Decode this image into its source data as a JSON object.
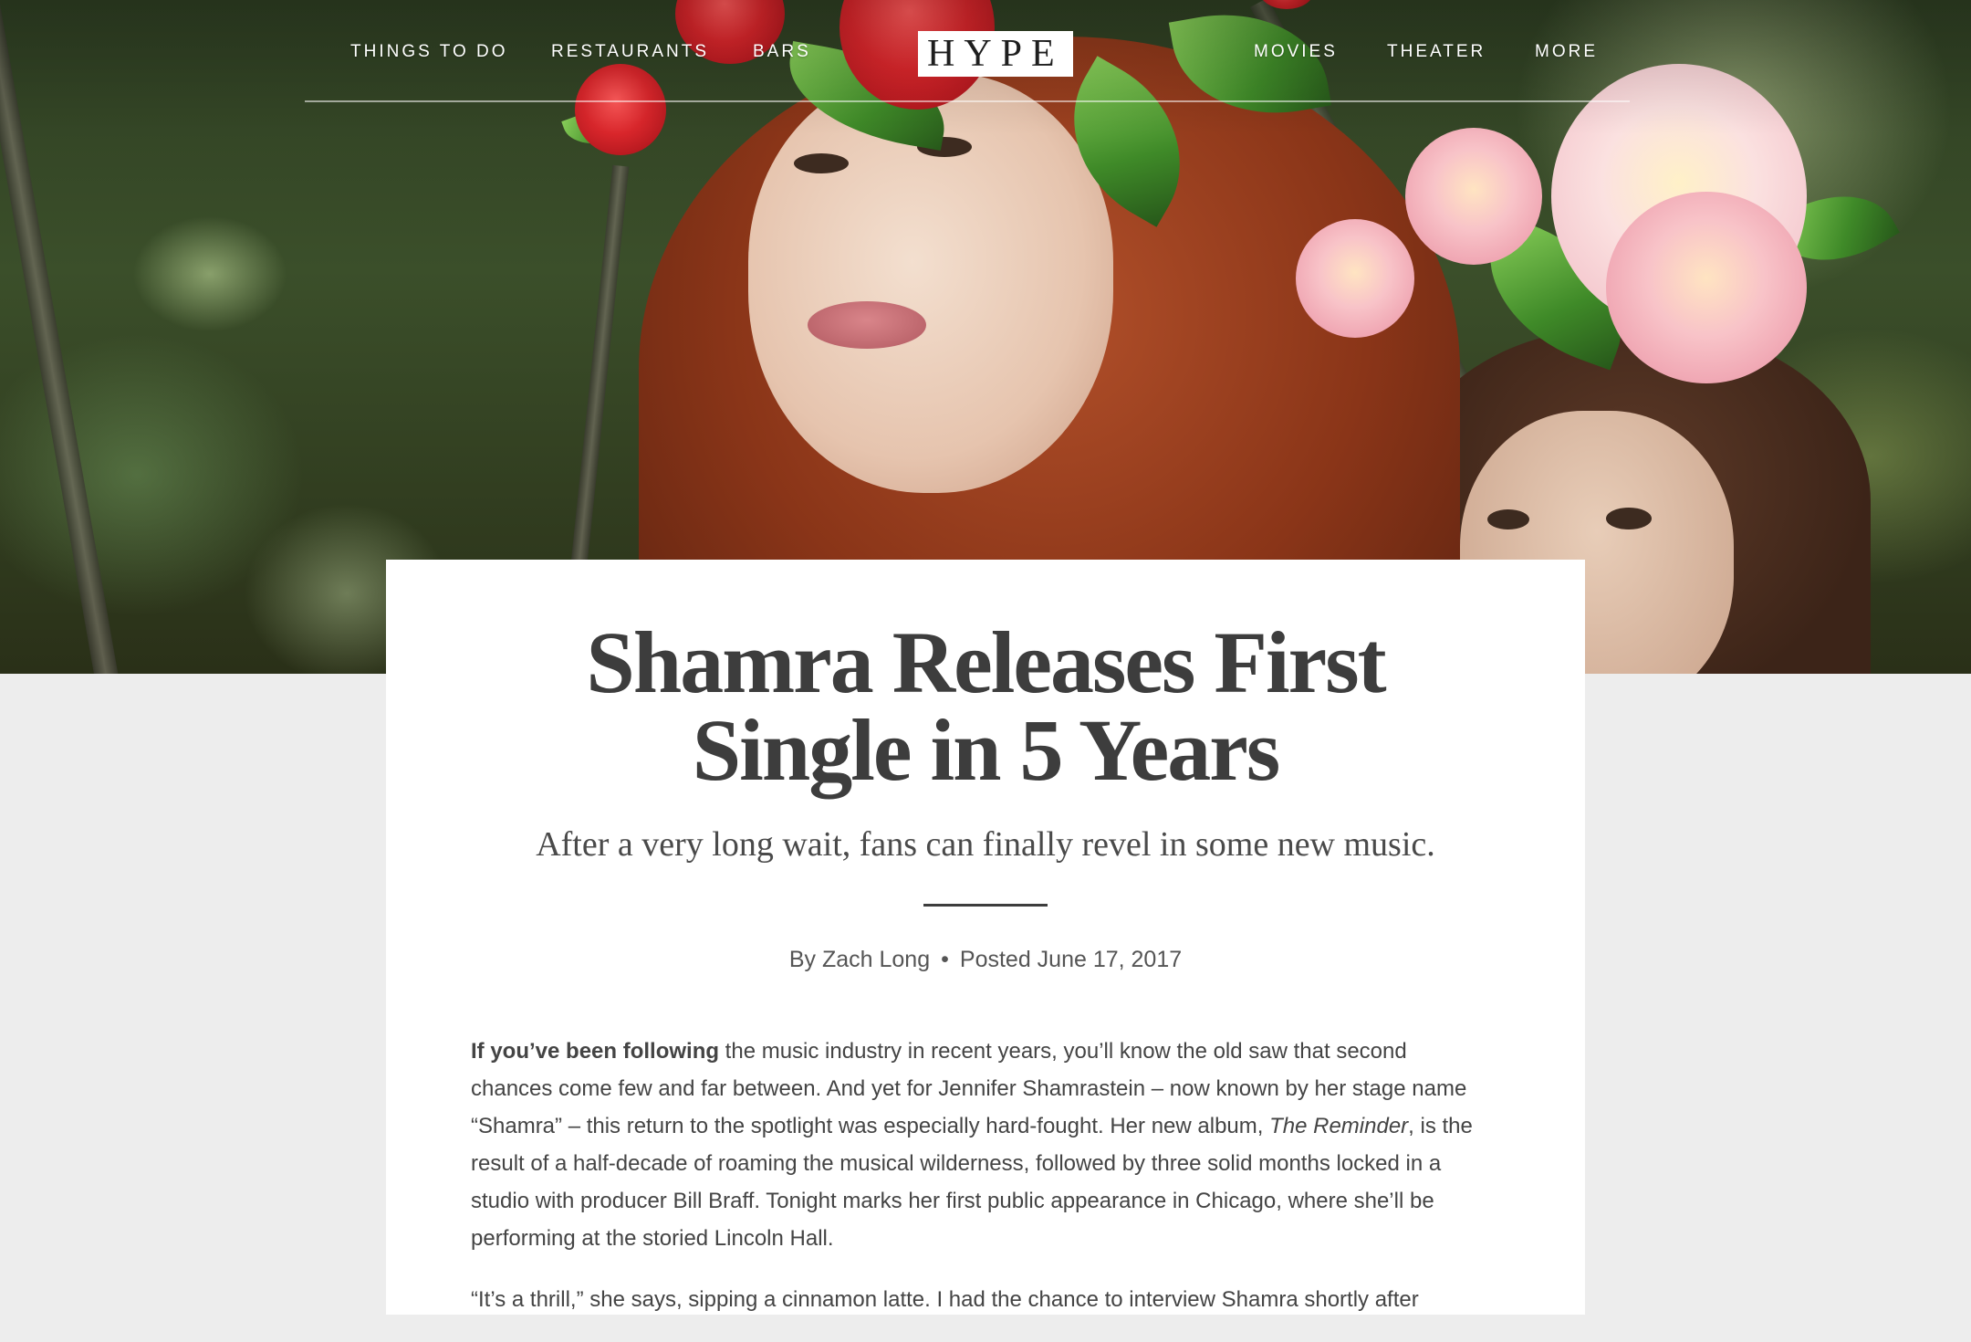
{
  "nav": {
    "left": [
      "THINGS TO DO",
      "RESTAURANTS",
      "BARS"
    ],
    "logo": "HYPE",
    "right": [
      "MOVIES",
      "THEATER",
      "MORE"
    ]
  },
  "article": {
    "title_line1": "Shamra Releases First",
    "title_line2": "Single in 5 Years",
    "subtitle": "After a very long wait, fans can finally revel in some new music.",
    "author": "By Zach Long",
    "separator": "•",
    "posted": "Posted June 17, 2017",
    "p1": {
      "lead": "If you’ve been following",
      "text_a": " the music industry in recent years, you’ll know the old saw that second chances come few and far between. And yet for Jennifer Shamrastein – now known by her stage name “Shamra” – this return to the spotlight was especially hard-fought. Her new album, ",
      "album": "The Reminder",
      "text_b": ", is the result of a half-decade of roaming the musical wilderness, followed by three solid months locked in a studio with producer Bill Braff. Tonight marks her first public appearance in Chicago, where she’ll be performing at the storied Lincoln Hall."
    },
    "p2": "“It’s a thrill,” she says, sipping a cinnamon latte. I had the chance to interview Shamra shortly after"
  },
  "colors": {
    "page_bg": "#ededed",
    "card_bg": "#ffffff",
    "headline": "#3d3d3d",
    "body_text": "#444444",
    "nav_text": "#ffffff"
  }
}
